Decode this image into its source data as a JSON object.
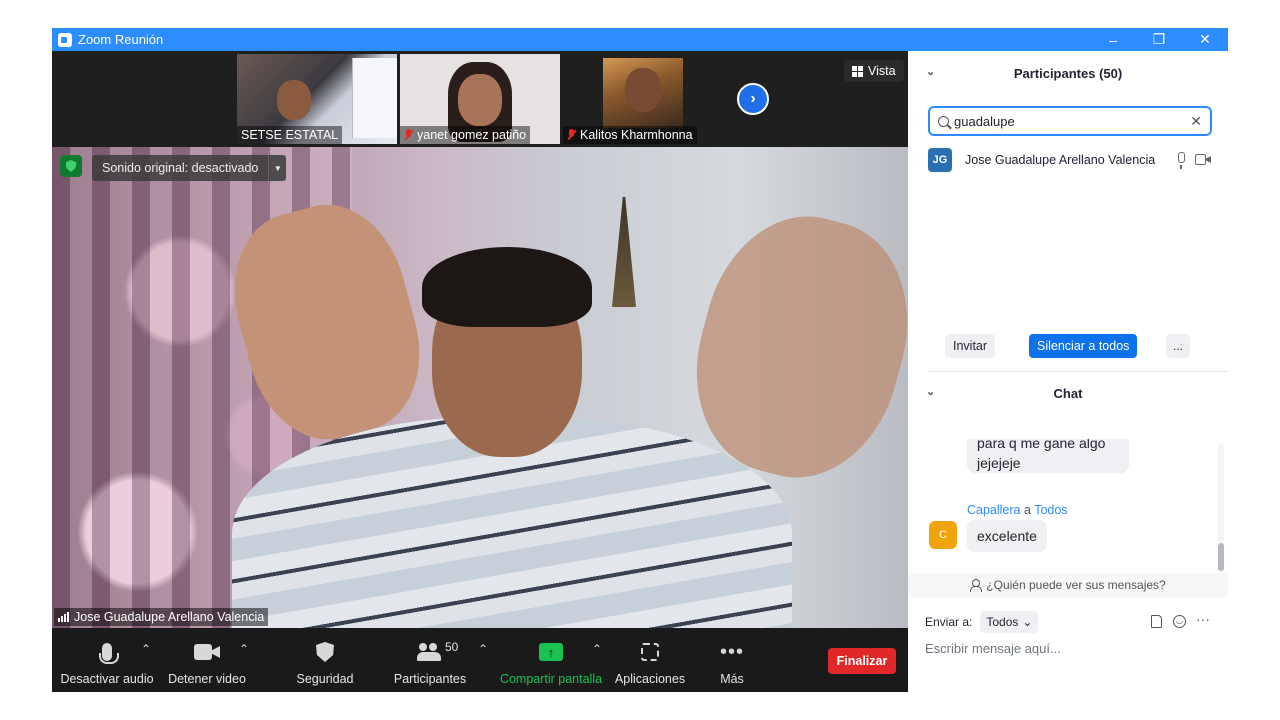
{
  "window": {
    "title": "Zoom Reunión",
    "controls": [
      "–",
      "❐",
      "✕"
    ]
  },
  "gallery": {
    "thumbnails": [
      {
        "name": "SETSE ESTATAL",
        "muted": false
      },
      {
        "name": "yanet gomez patiño",
        "muted": true
      },
      {
        "name": "Kalitos Kharmhonna",
        "muted": true
      }
    ],
    "next_arrow": "›",
    "view_label": "Vista"
  },
  "main_video": {
    "sound_option": "Sonido original: desactivado",
    "speaker_name": "Jose Guadalupe Arellano Valencia"
  },
  "toolbar": {
    "mute_label": "Desactivar audio",
    "video_label": "Detener video",
    "security_label": "Seguridad",
    "participants_label": "Participantes",
    "participants_count": "50",
    "share_label": "Compartir pantalla",
    "apps_label": "Aplicaciones",
    "more_label": "Más",
    "end_label": "Finalizar",
    "caret": "⌃"
  },
  "participants_panel": {
    "title": "Participantes (50)",
    "search_value": "guadalupe",
    "results": [
      {
        "initials": "JG",
        "name": "Jose Guadalupe Arellano Valencia"
      }
    ],
    "invite_label": "Invitar",
    "mute_all_label": "Silenciar a todos",
    "more_label": "..."
  },
  "chat_panel": {
    "title": "Chat",
    "messages": [
      {
        "text": "para q me gane algo jejejeje"
      },
      {
        "sender": "Capallera",
        "connector": "a",
        "recipient": "Todos",
        "initial": "C",
        "text": "excelente"
      }
    ],
    "who_sees": "¿Quién puede ver sus mensajes?",
    "send_to_label": "Enviar a:",
    "send_to_value": "Todos",
    "input_placeholder": "Escribir mensaje aquí...",
    "more_dots": "···"
  },
  "colors": {
    "brand_blue": "#2d8cff",
    "end_red": "#e02828",
    "share_green": "#19c153"
  }
}
